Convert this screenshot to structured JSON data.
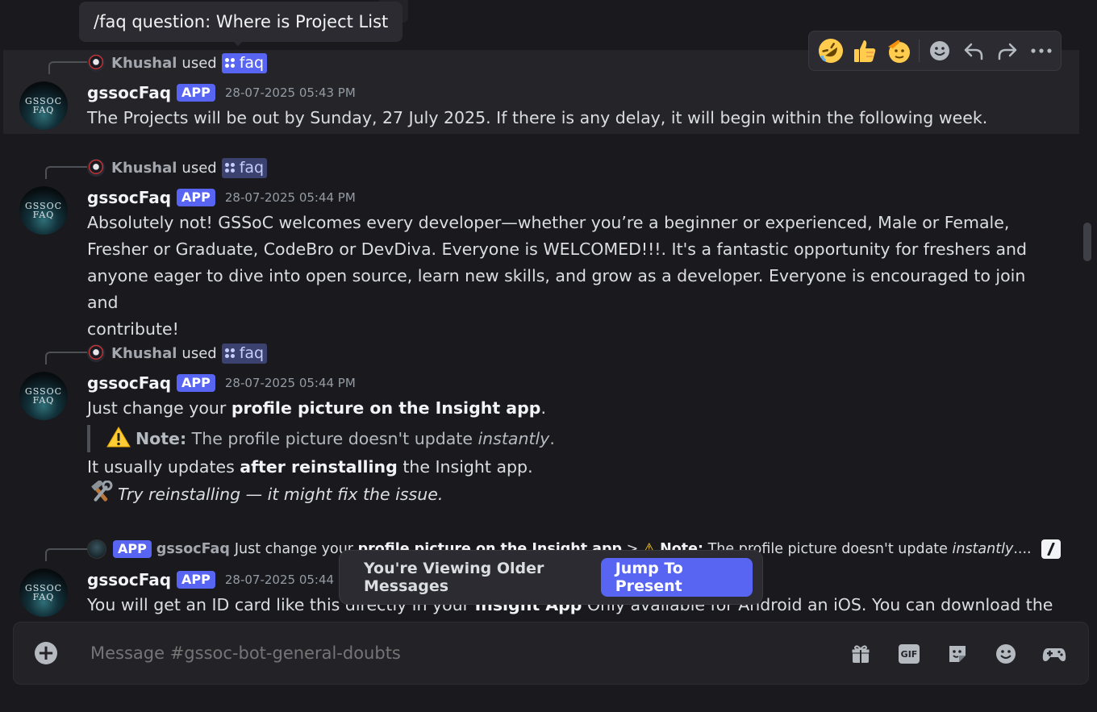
{
  "tooltip": {
    "text": "/faq question: Where is Project List"
  },
  "toolbar": {
    "reactions": [
      "rolling-on-floor-laughing",
      "thumbs-up",
      "saluting-face"
    ],
    "actions": [
      "add-reaction",
      "reply",
      "forward",
      "more"
    ]
  },
  "messages": [
    {
      "reply_user": "Khushal",
      "reply_used": "used",
      "command": "faq",
      "username": "gssocFaq",
      "badge": "APP",
      "timestamp": "28-07-2025 05:43 PM",
      "text": "The Projects will be out by Sunday, 27 July 2025. If there is any delay, it will begin within the following week."
    },
    {
      "reply_user": "Khushal",
      "reply_used": "used",
      "command": "faq",
      "username": "gssocFaq",
      "badge": "APP",
      "timestamp": "28-07-2025 05:44 PM",
      "lines": [
        "Absolutely not! GSSoC welcomes every developer—whether you’re a beginner or experienced, Male or Female,",
        "Fresher or Graduate, CodeBro or DevDiva. Everyone is WELCOMED!!!. It's a fantastic opportunity for freshers and",
        "anyone eager to dive into open source, learn new skills, and grow as a developer. Everyone is encouraged to join and",
        "contribute!"
      ]
    },
    {
      "reply_user": "Khushal",
      "reply_used": "used",
      "command": "faq",
      "username": "gssocFaq",
      "badge": "APP",
      "timestamp": "28-07-2025 05:44 PM",
      "line1_pre": "Just change your ",
      "line1_bold": "profile picture on the Insight app",
      "line1_post": ".",
      "note_label": "Note:",
      "note_text": " The profile picture doesn't update ",
      "note_italic": "instantly",
      "note_end": ".",
      "line3_pre": "It usually updates ",
      "line3_bold": "after reinstalling",
      "line3_post": " the Insight app.",
      "line4_italic": "Try reinstalling — it might fix the issue."
    },
    {
      "reply_badge": "APP",
      "reply_user": "gssocFaq",
      "reply_pre": "Just change your ",
      "reply_bold": "profile picture on the Insight app",
      "reply_mid": " > ",
      "reply_note": "Note:",
      "reply_text": " The profile picture doesn't update ",
      "reply_italic": "instantly",
      "reply_end": "....",
      "username": "gssocFaq",
      "badge": "APP",
      "timestamp": "28-07-2025 05:44 PM",
      "text_pre": "You will get an ID card like this directly in your ",
      "text_bold": "Insight App",
      "text_post": " Only available for Android an iOS. You can download the"
    }
  ],
  "avatar_text": [
    "GSSOC",
    "FAQ"
  ],
  "older_banner": {
    "text": "You're Viewing Older Messages",
    "button": "Jump To Present"
  },
  "composer": {
    "placeholder": "Message #gssoc-bot-general-doubts"
  },
  "composer_icons": [
    "gift-icon",
    "gif-icon",
    "sticker-icon",
    "emoji-icon",
    "game-controller-icon"
  ],
  "colors": {
    "accent": "#5865f2",
    "background": "#1a1a1e",
    "hover": "#242429"
  }
}
